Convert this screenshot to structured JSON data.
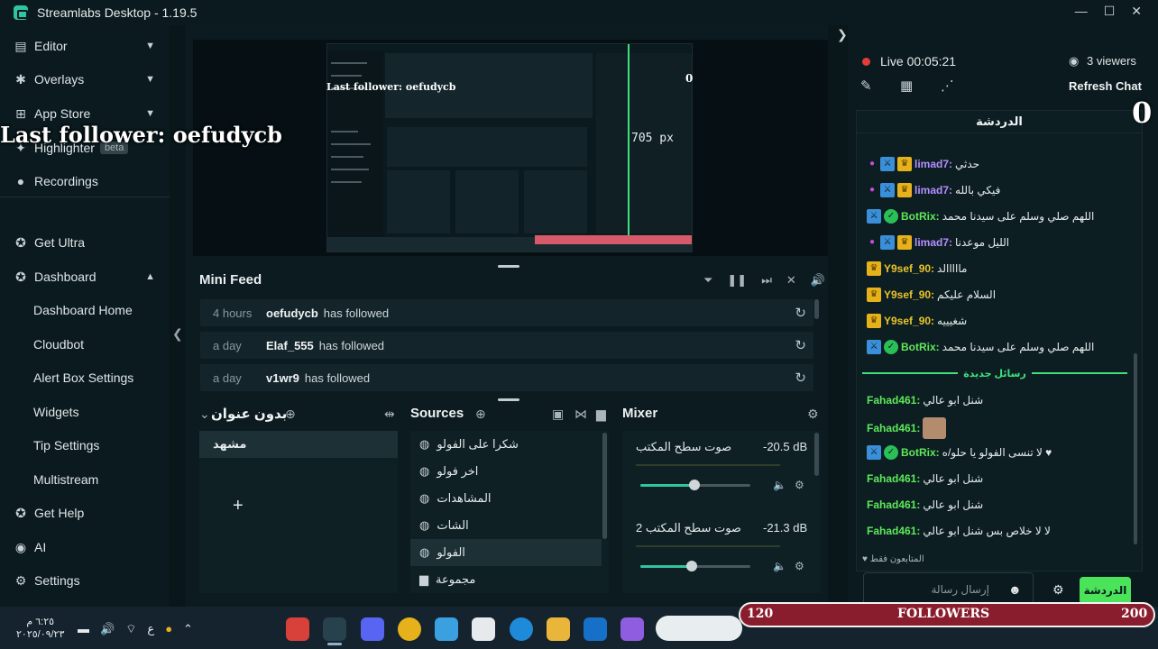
{
  "app": {
    "title": "Streamlabs Desktop - 1.19.5"
  },
  "sidebar": {
    "items": [
      {
        "label": "Editor",
        "icon": "editor-icon"
      },
      {
        "label": "Overlays",
        "icon": "overlays-icon"
      },
      {
        "label": "App Store",
        "icon": "store-icon"
      },
      {
        "label": "Highlighter",
        "badge": "beta",
        "icon": "highlighter-icon"
      },
      {
        "label": "Recordings",
        "icon": "recordings-icon"
      },
      {
        "label": "Get Ultra",
        "icon": "ultra-icon"
      },
      {
        "label": "Dashboard",
        "icon": "dashboard-icon"
      },
      {
        "label": "Dashboard Home"
      },
      {
        "label": "Cloudbot"
      },
      {
        "label": "Alert Box Settings"
      },
      {
        "label": "Widgets"
      },
      {
        "label": "Tip Settings"
      },
      {
        "label": "Multistream"
      },
      {
        "label": "Get Help",
        "icon": "help-icon"
      },
      {
        "label": "AI",
        "icon": "ai-icon"
      },
      {
        "label": "Settings",
        "icon": "settings-icon"
      }
    ]
  },
  "preview": {
    "resize_label": "705 px",
    "overlay_last_follower": "Last follower: oefudycb",
    "overlay_zero": "0"
  },
  "minifeed": {
    "title": "Mini Feed",
    "rows": [
      {
        "time": "4 hours",
        "user": "oefudycb",
        "action": "has followed"
      },
      {
        "time": "a day",
        "user": "Elaf_555",
        "action": "has followed"
      },
      {
        "time": "a day",
        "user": "v1wr9",
        "action": "has followed"
      }
    ]
  },
  "scenes": {
    "title": "بدون عنوان",
    "items": [
      "مشهد"
    ]
  },
  "sources": {
    "title": "Sources",
    "items": [
      "شكرا على الفولو",
      "اخر فولو",
      "المشاهدات",
      "الشات",
      "الفولو",
      "مجموعة"
    ],
    "selected_index": 4
  },
  "mixer": {
    "title": "Mixer",
    "channels": [
      {
        "name": "صوت سطح المكتب",
        "db": "-20.5 dB",
        "level": 0.49
      },
      {
        "name": "صوت سطح المكتب 2",
        "db": "-21.3 dB",
        "level": 0.47
      }
    ]
  },
  "chat_panel": {
    "live": "Live 00:05:21",
    "viewers": "3 viewers",
    "refresh": "Refresh Chat",
    "title": "الدردشة",
    "new_messages": "رسائل جديدة",
    "supporters": "المتابعون فقط",
    "input_placeholder": "إرسال رسالة",
    "send": "الدردشة",
    "messages": [
      {
        "nick": "limad7:",
        "text": "حدثي",
        "color": "purple",
        "badges": [
          "mic",
          "sword",
          "crown"
        ]
      },
      {
        "nick": "limad7:",
        "text": "فيكي بالله",
        "color": "purple",
        "badges": [
          "mic",
          "sword",
          "crown"
        ]
      },
      {
        "nick": "BotRix:",
        "text": "اللهم صلي وسلم على سيدنا محمد",
        "color": "green",
        "badges": [
          "sword",
          "verified"
        ]
      },
      {
        "nick": "limad7:",
        "text": "الليل موعدنا",
        "color": "purple",
        "badges": [
          "mic",
          "sword",
          "crown"
        ]
      },
      {
        "nick": "Y9sef_90:",
        "text": "مااااالد",
        "color": "gold",
        "badges": [
          "crown"
        ]
      },
      {
        "nick": "Y9sef_90:",
        "text": "السلام عليكم",
        "color": "gold",
        "badges": [
          "crown"
        ]
      },
      {
        "nick": "Y9sef_90:",
        "text": "شغيييه",
        "color": "gold",
        "badges": [
          "crown"
        ]
      },
      {
        "nick": "BotRix:",
        "text": "اللهم صلي وسلم على سيدنا محمد",
        "color": "green",
        "badges": [
          "sword",
          "verified"
        ]
      },
      {
        "nick": "Fahad461:",
        "text": "شنل ابو عالي",
        "color": "green",
        "badges": []
      },
      {
        "nick": "Fahad461:",
        "text": "",
        "color": "green",
        "badges": [],
        "emote": true
      },
      {
        "nick": "BotRix:",
        "text": "لا تنسى الفولو يا حلو/ه ♥",
        "color": "green",
        "badges": [
          "sword",
          "verified"
        ]
      },
      {
        "nick": "Fahad461:",
        "text": "شنل ابو عالي",
        "color": "green",
        "badges": []
      },
      {
        "nick": "Fahad461:",
        "text": "شنل ابو عالي",
        "color": "green",
        "badges": []
      },
      {
        "nick": "Fahad461:",
        "text": "لا لا خلاص بس شنل ابو عالي",
        "color": "green",
        "badges": []
      }
    ]
  },
  "chat_overlay": {
    "zero": "0"
  },
  "followers_goal": {
    "current": "120",
    "label": "FOLLOWERS",
    "goal": "200",
    "fraction": 0.6
  },
  "taskbar": {
    "time": "٦:٢٥ م",
    "date": "٢٠٢٥/٠٩/٢٣",
    "lang": "ع"
  },
  "colors": {
    "accent": "#31c3a2",
    "live": "#e23c3c",
    "chat_green": "#4be35a"
  }
}
